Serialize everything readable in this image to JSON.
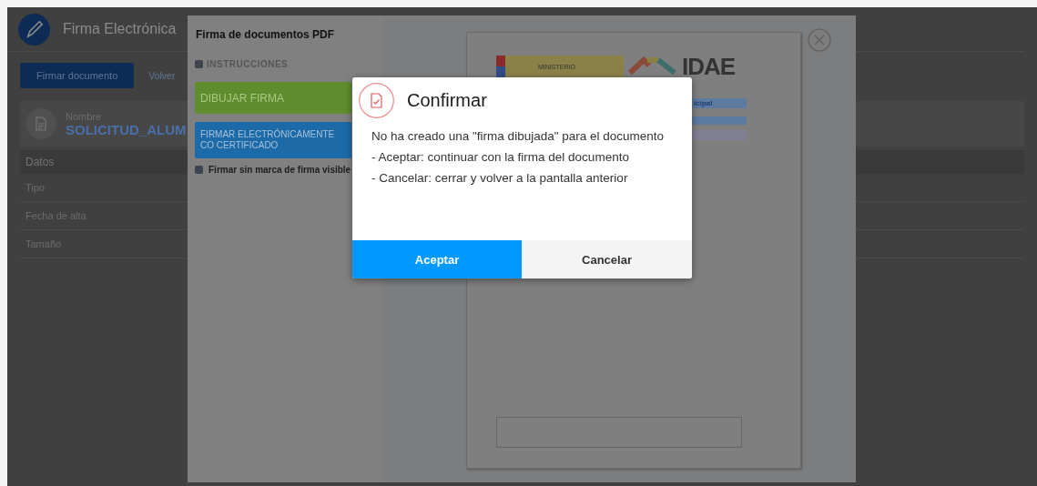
{
  "app": {
    "title": "Firma Electrónica",
    "actions": [
      {
        "label": "Firmar documento",
        "primary": true
      },
      {
        "label": "Volver",
        "primary": false
      }
    ],
    "file": {
      "label": "Nombre",
      "name": "SOLICITUD_ALUM"
    },
    "details": {
      "header": "Datos",
      "rows": [
        "Tipo",
        "Fecha de alta",
        "Tamaño"
      ]
    }
  },
  "modal": {
    "title": "Firma de documentos PDF",
    "instructions": "INSTRUCCIONES",
    "buttons": [
      {
        "label": "DIBUJAR FIRMA",
        "kind": "draw"
      },
      {
        "label": "FIRMAR ELECTRÓNICAMENTE CO CERTIFICADO",
        "kind": "certificate"
      }
    ],
    "option": "Firmar sin marca de firma visible",
    "document": {
      "ministry_text": "MINISTERIO",
      "logo_text": "IDAE",
      "bar_text": "icipal"
    }
  },
  "dialog": {
    "title": "Confirmar",
    "lines": [
      "No ha creado una \"firma dibujada\" para el documento",
      "- Aceptar: continuar con la firma del documento",
      "- Cancelar: cerrar y volver a la pantalla anterior"
    ],
    "buttons": [
      {
        "label": "Aceptar",
        "primary": true
      },
      {
        "label": "Cancelar",
        "primary": false
      }
    ]
  }
}
